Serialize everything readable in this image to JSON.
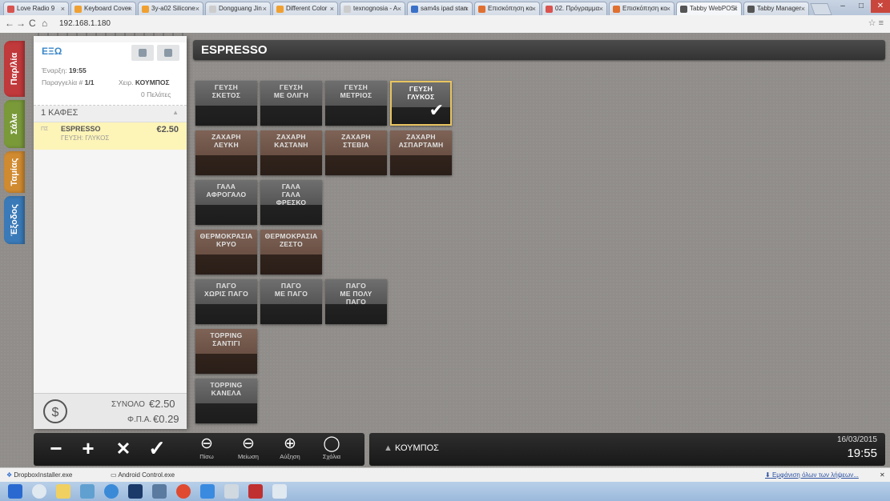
{
  "browser": {
    "tabs": [
      {
        "label": "Love Radio 9",
        "active": false,
        "color": "#d9534f"
      },
      {
        "label": "Keyboard Cover",
        "active": false,
        "color": "#f0a030"
      },
      {
        "label": "3y-a02 Silicone",
        "active": false,
        "color": "#f0a030"
      },
      {
        "label": "Dongguang Jin",
        "active": false,
        "color": "#cccccc"
      },
      {
        "label": "Different Color",
        "active": false,
        "color": "#f0a030"
      },
      {
        "label": "texnognosia - A",
        "active": false,
        "color": "#cccccc"
      },
      {
        "label": "sam4s ipad stan",
        "active": false,
        "color": "#3a70c8"
      },
      {
        "label": "Επισκόπηση κο",
        "active": false,
        "color": "#e07030"
      },
      {
        "label": "02. Πρόγραμμα",
        "active": false,
        "color": "#d9534f"
      },
      {
        "label": "Επισκόπηση κο",
        "active": false,
        "color": "#e07030"
      },
      {
        "label": "Tabby WebPOS!",
        "active": true,
        "color": "#555555"
      },
      {
        "label": "Tabby Manager",
        "active": false,
        "color": "#555555"
      }
    ],
    "url": "192.168.1.180",
    "window_buttons": [
      "–",
      "□",
      "✕"
    ]
  },
  "side_tabs": [
    {
      "label": "Παρ/λία",
      "color": "#c0393b"
    },
    {
      "label": "Σάλα",
      "color": "#7a9a3a"
    },
    {
      "label": "Ταμίας",
      "color": "#d08a30"
    },
    {
      "label": "Έξοδος",
      "color": "#3a7ab8"
    }
  ],
  "ticket": {
    "mode": "ΕΞΩ",
    "start_label": "Έναρξη:",
    "start_time": "19:55",
    "order_label": "Παραγγελία #",
    "order_no": "1/1",
    "waiter_label": "Χειρ.",
    "waiter": "ΚΟΥΜΠΟΣ",
    "customers": "0 Πελάτες",
    "category": "1 ΚΑΦΕΣ",
    "items": [
      {
        "qty": "ΠΣ",
        "name": "ESPRESSO",
        "modifier": "ΓΕΥΣΗ: ΓΛΥΚΟΣ",
        "price": "€2.50"
      }
    ],
    "total_label": "ΣΥΝΟΛΟ",
    "total": "€2.50",
    "vat_label": "Φ.Π.Α.",
    "vat": "€0.29"
  },
  "product": {
    "title": "ESPRESSO",
    "options": [
      {
        "line1": "ΓΕΥΣΗ",
        "line2": "ΣΚΕΤΟΣ",
        "line3": "",
        "style": "gray",
        "selected": false
      },
      {
        "line1": "ΓΕΥΣΗ",
        "line2": "ΜΕ ΟΛΙΓΗ",
        "line3": "",
        "style": "gray",
        "selected": false
      },
      {
        "line1": "ΓΕΥΣΗ",
        "line2": "ΜΕΤΡΙΟΣ",
        "line3": "",
        "style": "gray",
        "selected": false
      },
      {
        "line1": "ΓΕΥΣΗ",
        "line2": "ΓΛΥΚΟΣ",
        "line3": "",
        "style": "gray",
        "selected": true
      },
      {
        "line1": "ΖΑΧΑΡΗ",
        "line2": "ΛΕΥΚΗ",
        "line3": "",
        "style": "brown",
        "selected": false
      },
      {
        "line1": "ΖΑΧΑΡΗ",
        "line2": "ΚΑΣΤΑΝΗ",
        "line3": "",
        "style": "brown",
        "selected": false
      },
      {
        "line1": "ΖΑΧΑΡΗ",
        "line2": "ΣΤΕΒΙΑ",
        "line3": "",
        "style": "brown",
        "selected": false
      },
      {
        "line1": "ΖΑΧΑΡΗ",
        "line2": "ΑΣΠΑΡΤΑΜΗ",
        "line3": "",
        "style": "brown",
        "selected": false
      },
      {
        "line1": "ΓΑΛΑ",
        "line2": "ΑΦΡΟΓΑΛΟ",
        "line3": "",
        "style": "gray",
        "selected": false
      },
      {
        "line1": "ΓΑΛΑ",
        "line2": "ΓΑΛΑ",
        "line3": "ΦΡΕΣΚΟ",
        "style": "gray",
        "selected": false
      },
      {
        "line1": "ΘΕΡΜΟΚΡΑΣΙΑ",
        "line2": "ΚΡΥΟ",
        "line3": "",
        "style": "brown",
        "selected": false
      },
      {
        "line1": "ΘΕΡΜΟΚΡΑΣΙΑ",
        "line2": "ΖΕΣΤΟ",
        "line3": "",
        "style": "brown",
        "selected": false
      },
      {
        "line1": "ΠΑΓΟ",
        "line2": "ΧΩΡΙΣ ΠΑΓΟ",
        "line3": "",
        "style": "gray",
        "selected": false
      },
      {
        "line1": "ΠΑΓΟ",
        "line2": "ΜΕ ΠΑΓΟ",
        "line3": "",
        "style": "gray",
        "selected": false
      },
      {
        "line1": "ΠΑΓΟ",
        "line2": "ΜΕ ΠΟΛΥ",
        "line3": "ΠΑΓΟ",
        "style": "gray",
        "selected": false
      },
      {
        "line1": "TOPPING",
        "line2": "ΣΑΝΤΙΓΙ",
        "line3": "",
        "style": "brown",
        "selected": false
      },
      {
        "line1": "TOPPING",
        "line2": "ΚΑΝΕΛΑ",
        "line3": "",
        "style": "gray",
        "selected": false
      }
    ]
  },
  "toolbar": {
    "minus": "−",
    "plus": "+",
    "remove": "✕",
    "confirm": "✓",
    "back_label": "Πίσω",
    "decrease_label": "Μείωση",
    "increase_label": "Αύξηση",
    "comments_label": "Σχόλια"
  },
  "footer": {
    "table_name": "ΚΟΥΜΠΟΣ",
    "date": "16/03/2015",
    "time": "19:55"
  },
  "downloads": {
    "items": [
      "DropboxInstaller.exe",
      "Android Control.exe"
    ],
    "show_all": "Εμφάνιση όλων των λήψεων..."
  }
}
